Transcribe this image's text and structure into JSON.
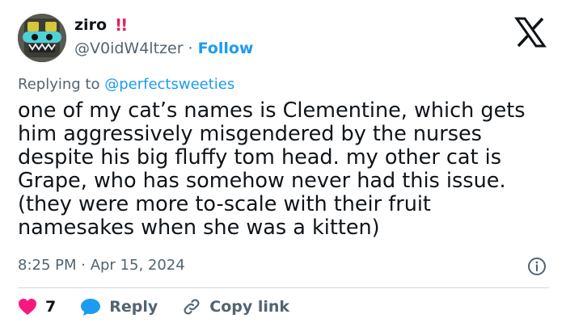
{
  "author": {
    "name": "ziro",
    "badge": "!!",
    "handle": "@V0idW4ltzer",
    "follow_label": "Follow"
  },
  "reply_context": {
    "prefix": "Replying to ",
    "mention": "@perfectsweeties"
  },
  "tweet": {
    "text": "one of my cat’s names is Clementine, which gets\nhim aggressively misgendered by the nurses\ndespite his big fluffy tom head. my other cat is\nGrape, who has somehow never had this issue.\n(they were more to-scale with their fruit\nnamesakes when she was a kitten)",
    "timestamp": "8:25 PM · Apr 15, 2024"
  },
  "actions": {
    "likes_count": "7",
    "reply_label": "Reply",
    "copy_link_label": "Copy link"
  },
  "colors": {
    "accent": "#1d9bf0",
    "like": "#f91880",
    "muted": "#536471"
  },
  "icons": [
    "x-logo-icon",
    "heart-icon",
    "reply-bubble-icon",
    "link-icon",
    "info-icon"
  ]
}
